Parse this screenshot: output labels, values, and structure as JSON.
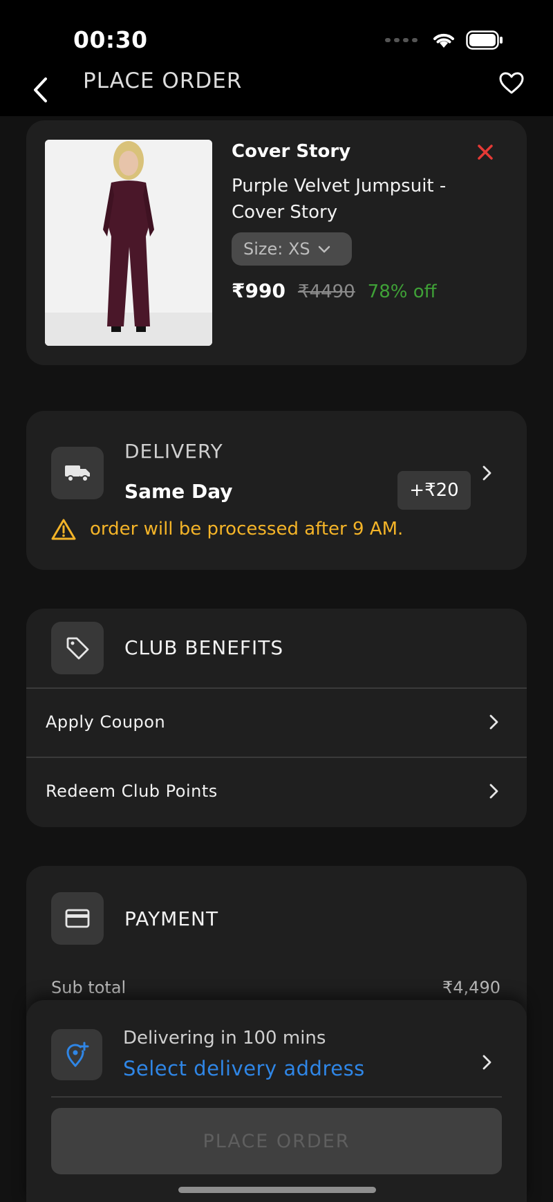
{
  "status_bar": {
    "time": "00:30"
  },
  "header": {
    "title": "PLACE ORDER"
  },
  "product": {
    "brand": "Cover Story",
    "name": "Purple Velvet Jumpsuit - Cover Story",
    "size_label": "Size: XS",
    "price": "₹990",
    "original_price": "₹4490",
    "discount": "78% off"
  },
  "delivery": {
    "section_title": "DELIVERY",
    "type": "Same Day",
    "fee": "+₹20",
    "warning": "order will be processed after 9 AM."
  },
  "club": {
    "section_title": "CLUB BENEFITS",
    "items": [
      {
        "label": "Apply Coupon"
      },
      {
        "label": "Redeem Club Points"
      }
    ]
  },
  "payment": {
    "section_title": "PAYMENT",
    "subtotal_label": "Sub total",
    "subtotal_value": "₹4,490"
  },
  "bottom_sheet": {
    "eta": "Delivering in 100 mins",
    "address_link": "Select delivery address",
    "place_order_label": "PLACE ORDER"
  },
  "colors": {
    "background": "#121212",
    "card": "#1f1f1f",
    "discount_green": "#3fa137",
    "warning_amber": "#f4b428",
    "link_blue": "#2f86e6",
    "remove_red": "#e53935"
  }
}
